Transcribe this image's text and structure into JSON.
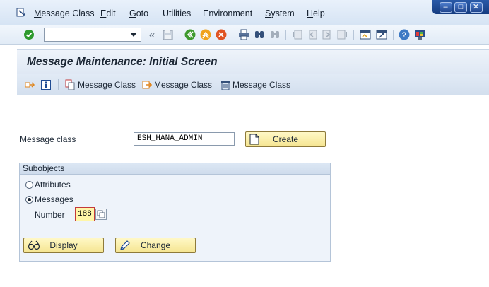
{
  "menubar": {
    "items": [
      {
        "label": "Message Class",
        "ul": "M",
        "rest": "essage Class"
      },
      {
        "label": "Edit",
        "ul": "E",
        "rest": "dit"
      },
      {
        "label": "Goto",
        "ul": "G",
        "rest": "oto"
      },
      {
        "label": "Utilities",
        "ul": "",
        "rest": "Utilities"
      },
      {
        "label": "Environment",
        "ul": "",
        "rest": "Environment"
      },
      {
        "label": "System",
        "ul": "S",
        "rest": "ystem"
      },
      {
        "label": "Help",
        "ul": "H",
        "rest": "elp"
      }
    ],
    "window_controls": {
      "minimize": "–",
      "maximize": "□",
      "close": "✕"
    }
  },
  "toolbar": {
    "command_value": "",
    "back_glyph": "«",
    "icons": [
      "enter-icon",
      "save-icon",
      "back-icon",
      "exit-icon",
      "cancel-icon",
      "print-icon",
      "find-icon",
      "find-next-icon",
      "first-page-icon",
      "previous-page-icon",
      "next-page-icon",
      "last-page-icon",
      "create-session-icon",
      "shortcut-icon",
      "help-icon",
      "layout-menu-icon"
    ]
  },
  "title": "Message Maintenance: Initial Screen",
  "app_toolbar": {
    "copy_label": "Message Class",
    "rename_label": "Message Class",
    "delete_label": "Message Class"
  },
  "form": {
    "message_class_label": "Message class",
    "message_class_value": "ESH_HANA_ADMIN",
    "create_label": "Create",
    "subobjects_title": "Subobjects",
    "attributes_label": "Attributes",
    "messages_label": "Messages",
    "number_label": "Number",
    "number_value": "188",
    "display_label": "Display",
    "change_label": "Change",
    "selected_subobject": "Messages"
  },
  "colors": {
    "accent_blue": "#1f4b93",
    "button_yellow": "#f5e591",
    "enter_green": "#2e9a2e"
  }
}
